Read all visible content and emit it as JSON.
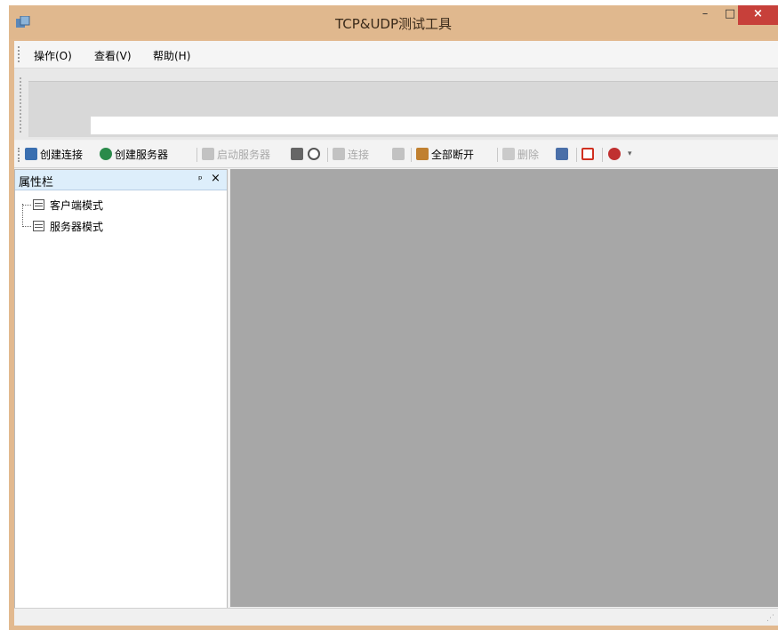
{
  "window": {
    "title": "TCP&UDP测试工具",
    "minimize_glyph": "–",
    "maximize_glyph": "□",
    "close_glyph": "×",
    "icon": "app-icon",
    "close_color": "#c7403a",
    "frame_color": "#e0b88e"
  },
  "menu": {
    "items": [
      "操作(O)",
      "查看(V)",
      "帮助(H)"
    ]
  },
  "toolbar": {
    "items": [
      {
        "label": "创建连接",
        "icon": "create-connection-icon",
        "enabled": true,
        "color": "#3a6fb0"
      },
      {
        "label": "创建服务器",
        "icon": "create-server-icon",
        "enabled": true,
        "color": "#2a8a4a"
      },
      {
        "label": "启动服务器",
        "icon": "start-server-icon",
        "enabled": false,
        "color": "#888888"
      },
      {
        "label": "",
        "icon": "stop-server-icon",
        "enabled": true,
        "color": "#666666"
      },
      {
        "label": "",
        "icon": "refresh-icon",
        "enabled": true,
        "color": "#555555"
      },
      {
        "label": "连接",
        "icon": "connect-icon",
        "enabled": false,
        "color": "#888888"
      },
      {
        "label": "",
        "icon": "disconnect-icon",
        "enabled": false,
        "color": "#888888"
      },
      {
        "label": "全部断开",
        "icon": "disconnect-all-icon",
        "enabled": true,
        "color": "#c08030"
      },
      {
        "label": "删除",
        "icon": "delete-icon",
        "enabled": false,
        "color": "#999999"
      },
      {
        "label": "",
        "icon": "settings-icon",
        "enabled": true,
        "color": "#4a6fa8"
      },
      {
        "label": "",
        "icon": "record-icon",
        "enabled": true,
        "color": "#d03020"
      },
      {
        "label": "",
        "icon": "help-icon",
        "enabled": true,
        "color": "#c03030"
      }
    ]
  },
  "panel": {
    "title": "属性栏",
    "pin_glyph": "ᵖ",
    "close_glyph": "×",
    "tree": [
      "客户端模式",
      "服务器模式"
    ]
  },
  "status": {
    "resize_glyph": "⋰"
  }
}
